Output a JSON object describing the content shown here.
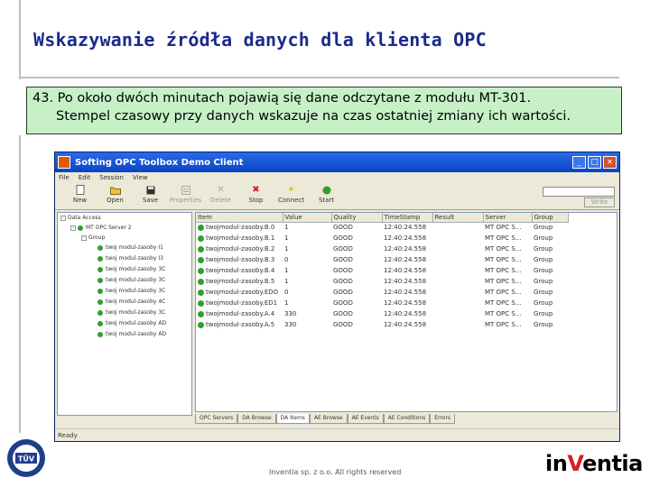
{
  "slide": {
    "title": "Wskazywanie źródła danych dla klienta OPC",
    "note_line1": "43. Po około dwóch minutach pojawią się dane odczytane z modułu MT-301.",
    "note_line2": "Stempel czasowy przy danych wskazuje na czas ostatniej zmiany ich wartości.",
    "footer": "Inventia sp. z o.o. All rights reserved",
    "logo_prefix": "in",
    "logo_v": "V",
    "logo_suffix": "entia",
    "tuv_text": "TÜV"
  },
  "window": {
    "title": "Softing OPC Toolbox Demo Client",
    "menu": [
      "File",
      "Edit",
      "Session",
      "View"
    ],
    "toolbar": [
      {
        "label": "New",
        "icon": "new-icon",
        "enabled": true
      },
      {
        "label": "Open",
        "icon": "open-icon",
        "enabled": true
      },
      {
        "label": "Save",
        "icon": "save-icon",
        "enabled": true
      },
      {
        "label": "Properties",
        "icon": "properties-icon",
        "enabled": false
      },
      {
        "label": "Delete",
        "icon": "delete-icon",
        "enabled": false
      },
      {
        "label": "Stop",
        "icon": "stop-icon",
        "enabled": true
      },
      {
        "label": "Connect",
        "icon": "connect-icon",
        "enabled": true
      },
      {
        "label": "Start",
        "icon": "start-icon",
        "enabled": true
      }
    ],
    "write_button": "Write",
    "tree": {
      "root": "Data Access",
      "server": "MT OPC Server 2",
      "group": "Group",
      "items": [
        "twoj modul-zasoby I1",
        "twoj modul-zasoby I3",
        "twoj modul-zasoby 3C",
        "twoj modul-zasoby 3C",
        "twoj modul-zasoby 3C",
        "twoj modul-zasoby 4C",
        "twoj modul-zasoby 3C",
        "twoj modul-zasoby AD",
        "twoj modul-zasoby AD"
      ]
    },
    "columns": [
      "Item",
      "Value",
      "Quality",
      "TimeStamp",
      "Result",
      "Server",
      "Group"
    ],
    "rows": [
      [
        "twojmodul-zasoby.B.0",
        "1",
        "GOOD",
        "12:40:24.558",
        "",
        "MT OPC S...",
        "Group"
      ],
      [
        "twojmodul-zasoby.B.1",
        "1",
        "GOOD",
        "12:40:24.558",
        "",
        "MT OPC S...",
        "Group"
      ],
      [
        "twojmodul-zasoby.B.2",
        "1",
        "GOOD",
        "12:40:24.558",
        "",
        "MT OPC S...",
        "Group"
      ],
      [
        "twojmodul-zasoby.B.3",
        "0",
        "GOOD",
        "12:40:24.558",
        "",
        "MT OPC S...",
        "Group"
      ],
      [
        "twojmodul-zasoby.B.4",
        "1",
        "GOOD",
        "12:40:24.558",
        "",
        "MT OPC S...",
        "Group"
      ],
      [
        "twojmodul-zasoby.B.5",
        "1",
        "GOOD",
        "12:40:24.558",
        "",
        "MT OPC S...",
        "Group"
      ],
      [
        "twojmodul-zasoby.EDO",
        "0",
        "GOOD",
        "12:40:24.558",
        "",
        "MT OPC S...",
        "Group"
      ],
      [
        "twojmodul-zasoby.ED1",
        "1",
        "GOOD",
        "12:40:24.558",
        "",
        "MT OPC S...",
        "Group"
      ],
      [
        "twojmodul-zasoby.A.4",
        "330",
        "GOOD",
        "12:40:24.558",
        "",
        "MT OPC S...",
        "Group"
      ],
      [
        "twojmodul-zasoby.A.5",
        "330",
        "GOOD",
        "12:40:24.558",
        "",
        "MT OPC S...",
        "Group"
      ]
    ],
    "tabs": [
      "OPC Servers",
      "DA Browse",
      "DA Items",
      "AE Browse",
      "AE Events",
      "AE Conditions",
      "Errors"
    ],
    "active_tab": "DA Items",
    "status": "Ready"
  }
}
